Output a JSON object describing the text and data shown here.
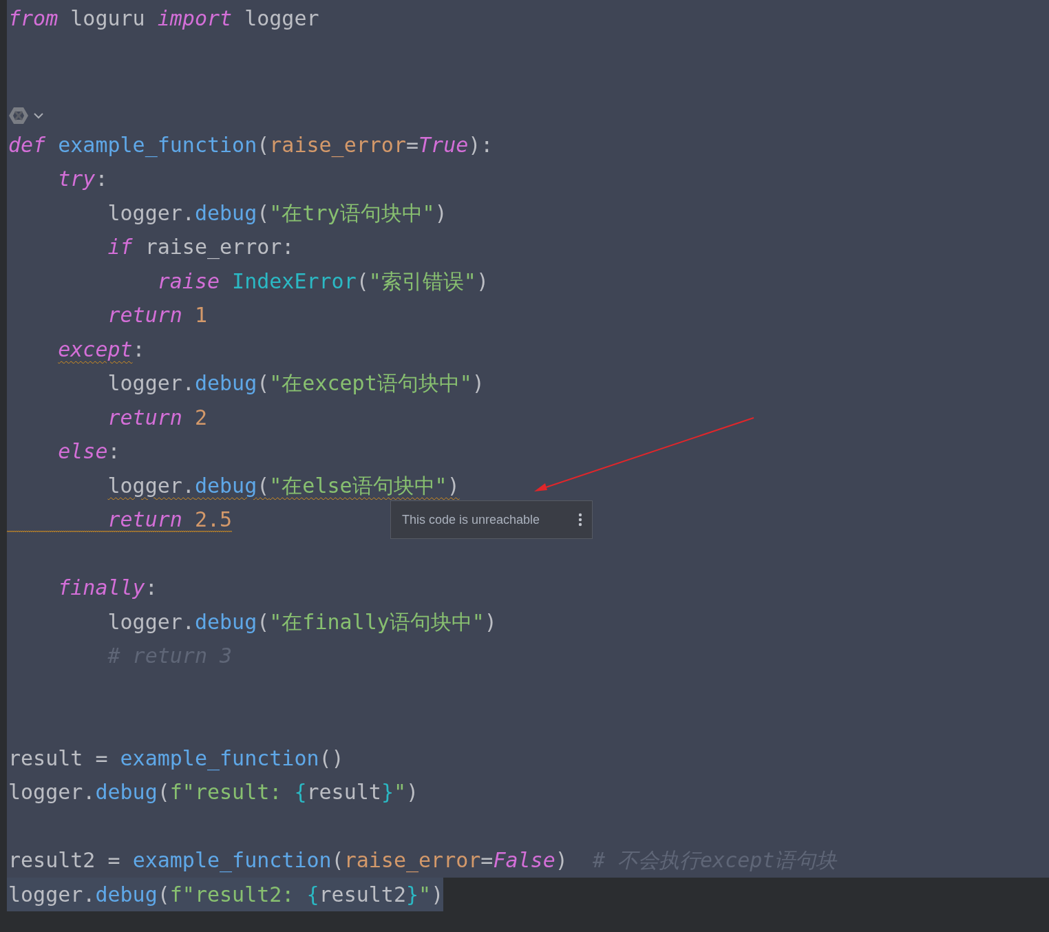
{
  "editor": {
    "lines": [
      {
        "kind": "code",
        "tokens": [
          {
            "text": "from",
            "kind": "keyword"
          },
          {
            "text": " loguru ",
            "kind": "plain"
          },
          {
            "text": "import",
            "kind": "keyword"
          },
          {
            "text": " logger",
            "kind": "plain"
          }
        ]
      },
      {
        "kind": "blank"
      },
      {
        "kind": "blank"
      },
      {
        "kind": "inlay"
      },
      {
        "kind": "code",
        "tokens": [
          {
            "text": "def",
            "kind": "keyword"
          },
          {
            "text": " example_function",
            "kind": "function"
          },
          {
            "text": "(",
            "kind": "plain"
          },
          {
            "text": "raise_error",
            "kind": "param"
          },
          {
            "text": "=",
            "kind": "plain"
          },
          {
            "text": "True",
            "kind": "keyword"
          },
          {
            "text": "):",
            "kind": "plain"
          }
        ],
        "children": [
          {
            "kind": "code",
            "tokens": [
              {
                "text": "try",
                "kind": "keyword"
              },
              {
                "text": ":",
                "kind": "plain"
              }
            ],
            "children": [
              {
                "kind": "code",
                "tokens": [
                  {
                    "text": "logger.",
                    "kind": "plain"
                  },
                  {
                    "text": "debug",
                    "kind": "function"
                  },
                  {
                    "text": "(",
                    "kind": "plain"
                  },
                  {
                    "text": "\"在try语句块中\"",
                    "kind": "string"
                  },
                  {
                    "text": ")",
                    "kind": "plain"
                  }
                ]
              },
              {
                "kind": "code",
                "tokens": [
                  {
                    "text": "if",
                    "kind": "keyword"
                  },
                  {
                    "text": " raise_error:",
                    "kind": "plain"
                  }
                ],
                "children": [
                  {
                    "kind": "code",
                    "tokens": [
                      {
                        "text": "raise",
                        "kind": "keyword"
                      },
                      {
                        "text": " IndexError",
                        "kind": "class"
                      },
                      {
                        "text": "(",
                        "kind": "plain"
                      },
                      {
                        "text": "\"索引错误\"",
                        "kind": "string"
                      },
                      {
                        "text": ")",
                        "kind": "plain"
                      }
                    ]
                  }
                ]
              },
              {
                "kind": "code",
                "tokens": [
                  {
                    "text": "return",
                    "kind": "keyword"
                  },
                  {
                    "text": " 1",
                    "kind": "number"
                  }
                ]
              }
            ]
          },
          {
            "kind": "code",
            "tokens": [
              {
                "text": "except",
                "kind": "keyword",
                "warning": true
              },
              {
                "text": ":",
                "kind": "plain"
              }
            ],
            "children": [
              {
                "kind": "code",
                "tokens": [
                  {
                    "text": "logger.",
                    "kind": "plain"
                  },
                  {
                    "text": "debug",
                    "kind": "function"
                  },
                  {
                    "text": "(",
                    "kind": "plain"
                  },
                  {
                    "text": "\"在except语句块中\"",
                    "kind": "string"
                  },
                  {
                    "text": ")",
                    "kind": "plain"
                  }
                ]
              },
              {
                "kind": "code",
                "tokens": [
                  {
                    "text": "return",
                    "kind": "keyword"
                  },
                  {
                    "text": " 2",
                    "kind": "number"
                  }
                ]
              }
            ]
          },
          {
            "kind": "code",
            "tokens": [
              {
                "text": "else",
                "kind": "keyword"
              },
              {
                "text": ":",
                "kind": "plain"
              }
            ],
            "children": [
              {
                "kind": "code",
                "tokens": [
                  {
                    "text": "logger.",
                    "kind": "plain",
                    "warning": true
                  },
                  {
                    "text": "debug",
                    "kind": "function",
                    "warning": true
                  },
                  {
                    "text": "(",
                    "kind": "plain",
                    "warning": true
                  },
                  {
                    "text": "\"在else语句块中\"",
                    "kind": "string",
                    "warning": true
                  },
                  {
                    "text": ")",
                    "kind": "plain",
                    "warning": true
                  }
                ]
              },
              {
                "kind": "code",
                "warning": true,
                "tokens": [
                  {
                    "text": "return",
                    "kind": "keyword"
                  },
                  {
                    "text": " 2.5",
                    "kind": "number"
                  }
                ]
              }
            ]
          },
          {
            "kind": "blank"
          },
          {
            "kind": "code",
            "tokens": [
              {
                "text": "finally",
                "kind": "keyword"
              },
              {
                "text": ":",
                "kind": "plain"
              }
            ],
            "children": [
              {
                "kind": "code",
                "tokens": [
                  {
                    "text": "logger.",
                    "kind": "plain"
                  },
                  {
                    "text": "debug",
                    "kind": "function"
                  },
                  {
                    "text": "(",
                    "kind": "plain"
                  },
                  {
                    "text": "\"在finally语句块中\"",
                    "kind": "string"
                  },
                  {
                    "text": ")",
                    "kind": "plain"
                  }
                ]
              },
              {
                "kind": "code",
                "tokens": [
                  {
                    "text": "# return 3",
                    "kind": "comment"
                  }
                ]
              }
            ]
          }
        ]
      },
      {
        "kind": "blank"
      },
      {
        "kind": "blank"
      },
      {
        "kind": "code",
        "tokens": [
          {
            "text": "result = ",
            "kind": "plain"
          },
          {
            "text": "example_function",
            "kind": "function"
          },
          {
            "text": "()",
            "kind": "plain"
          }
        ]
      },
      {
        "kind": "code",
        "tokens": [
          {
            "text": "logger.",
            "kind": "plain"
          },
          {
            "text": "debug",
            "kind": "function"
          },
          {
            "text": "(",
            "kind": "plain"
          },
          {
            "text": "f\"result: ",
            "kind": "string"
          },
          {
            "text": "{",
            "kind": "brace"
          },
          {
            "text": "result",
            "kind": "plain"
          },
          {
            "text": "}",
            "kind": "brace"
          },
          {
            "text": "\"",
            "kind": "string"
          },
          {
            "text": ")",
            "kind": "plain"
          }
        ]
      },
      {
        "kind": "blank"
      },
      {
        "kind": "code",
        "tokens": [
          {
            "text": "result2 = ",
            "kind": "plain"
          },
          {
            "text": "example_function",
            "kind": "function"
          },
          {
            "text": "(",
            "kind": "plain"
          },
          {
            "text": "raise_error",
            "kind": "param"
          },
          {
            "text": "=",
            "kind": "plain"
          },
          {
            "text": "False",
            "kind": "keyword"
          },
          {
            "text": ")  ",
            "kind": "plain"
          },
          {
            "text": "# 不会执行except语句块",
            "kind": "comment"
          }
        ]
      },
      {
        "kind": "code",
        "selected": true,
        "tokens": [
          {
            "text": "logger.",
            "kind": "plain"
          },
          {
            "text": "debug",
            "kind": "function"
          },
          {
            "text": "(",
            "kind": "plain"
          },
          {
            "text": "f\"result2: ",
            "kind": "string"
          },
          {
            "text": "{",
            "kind": "brace"
          },
          {
            "text": "result2",
            "kind": "plain"
          },
          {
            "text": "}",
            "kind": "brace"
          },
          {
            "text": "\"",
            "kind": "string"
          },
          {
            "text": ")",
            "kind": "plain"
          }
        ]
      }
    ]
  },
  "tooltip": {
    "text": "This code is unreachable"
  }
}
